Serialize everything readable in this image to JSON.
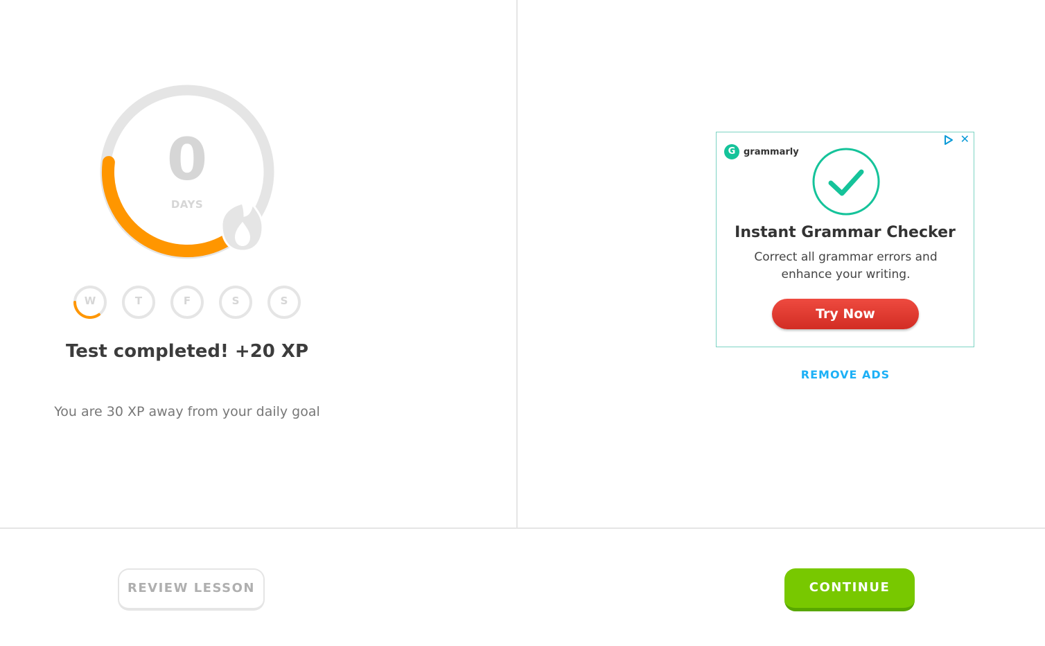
{
  "streak": {
    "count": "0",
    "unit": "DAYS",
    "progress_fraction": 0.35,
    "days": [
      {
        "label": "W",
        "progress_fraction": 0.35
      },
      {
        "label": "T",
        "progress_fraction": 0
      },
      {
        "label": "F",
        "progress_fraction": 0
      },
      {
        "label": "S",
        "progress_fraction": 0
      },
      {
        "label": "S",
        "progress_fraction": 0
      }
    ]
  },
  "result": {
    "title": "Test completed! +20 XP",
    "goal_message": "You are 30 XP away from your daily goal"
  },
  "ad": {
    "brand": "grammarly",
    "headline": "Instant Grammar Checker",
    "body": "Correct all grammar errors and enhance your writing.",
    "cta": "Try Now",
    "close_glyph": "✕"
  },
  "remove_ads": "REMOVE ADS",
  "footer": {
    "review_label": "REVIEW LESSON",
    "continue_label": "CONTINUE"
  },
  "colors": {
    "streak_orange": "#ff9600",
    "continue_green": "#78c800",
    "link_blue": "#1cb0f6",
    "ring_gray": "#e5e5e5"
  }
}
